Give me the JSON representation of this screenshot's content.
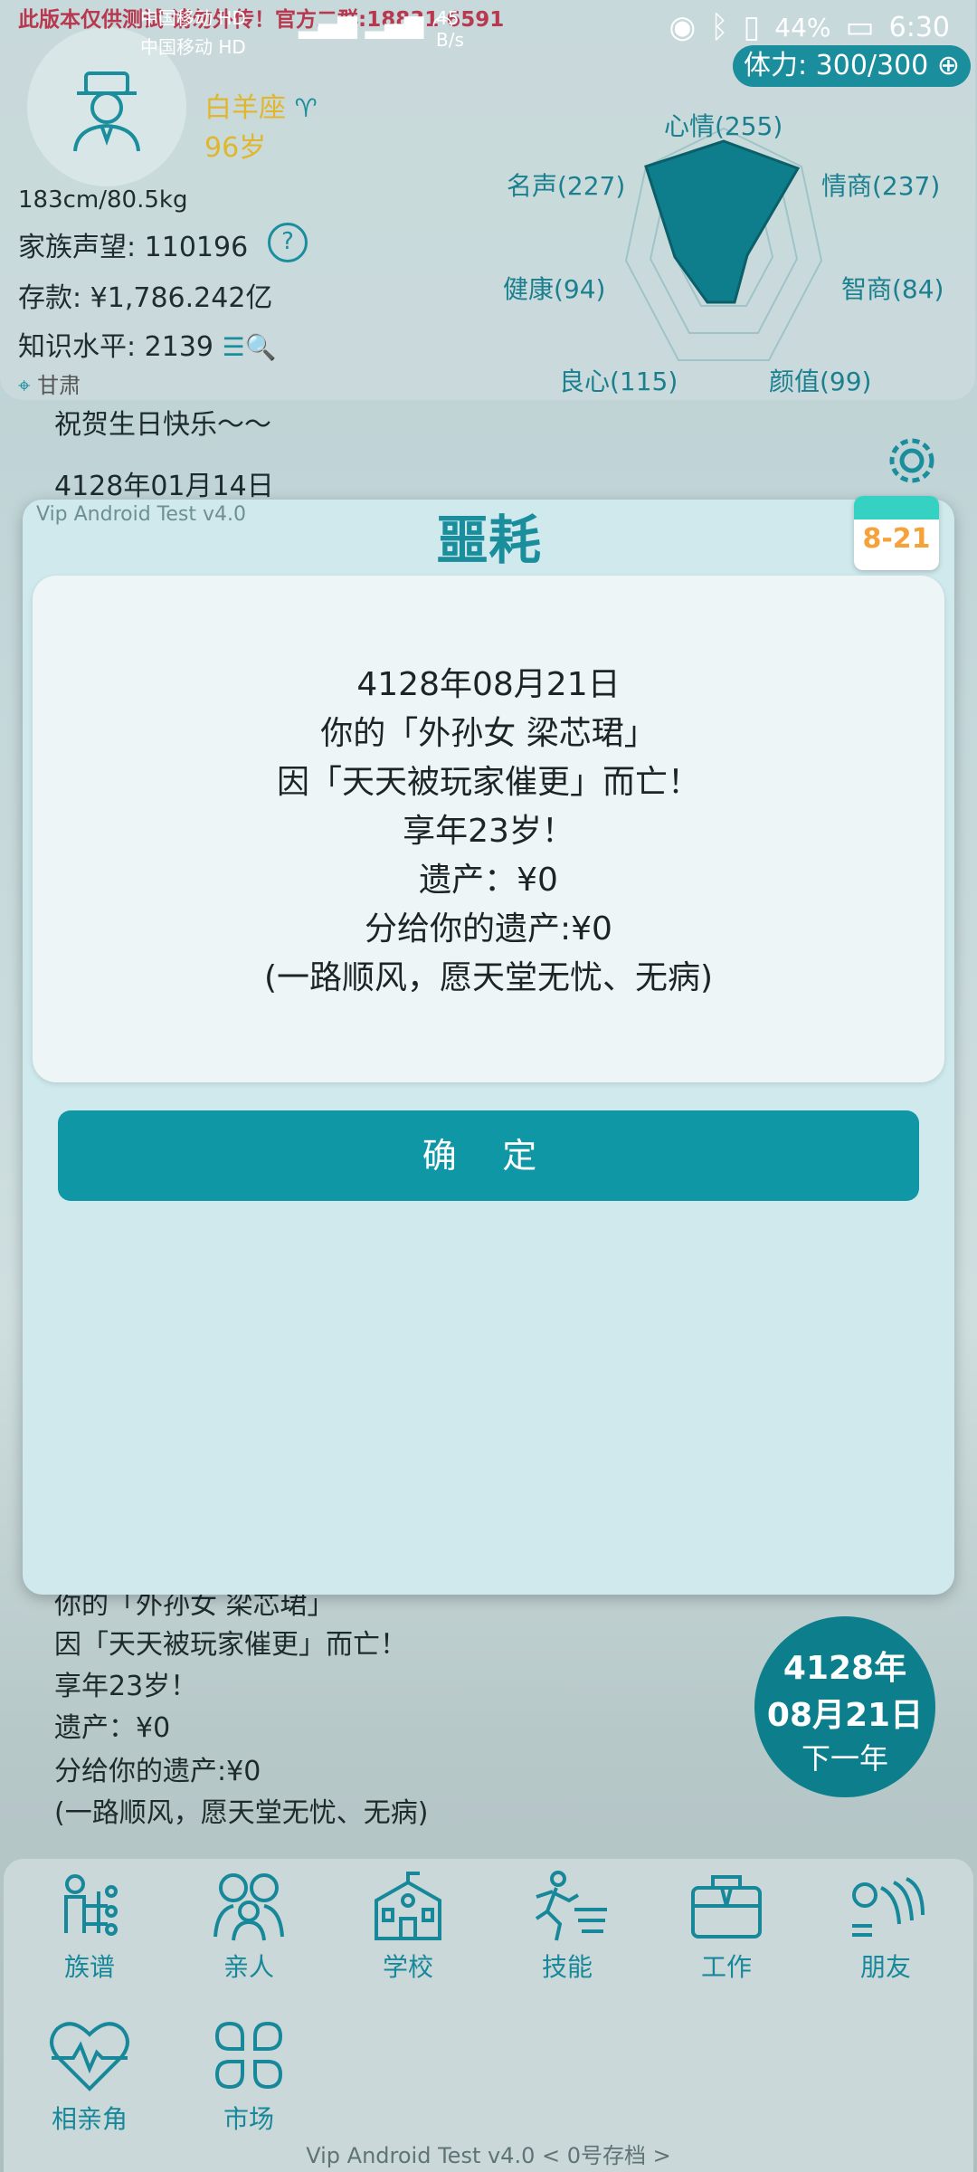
{
  "status_bar": {
    "notice": "此版本仅供测试 请勿外传！官方二群:18831 6591",
    "carrier1": "中国移动 HD",
    "carrier2": "中国移动 HD",
    "speed": "45 B/s",
    "battery": "44%",
    "time": "6:30"
  },
  "profile": {
    "sign": "白羊座",
    "age": "96岁",
    "height_weight": "183cm/80.5kg",
    "family_prestige": "家族声望: 110196",
    "savings": "存款: ¥1,786.242亿",
    "knowledge": "知识水平: 2139",
    "location": "甘肃",
    "energy": "体力: 300/300"
  },
  "radar": {
    "mood": "心情(255)",
    "eq": "情商(237)",
    "iq": "智商(84)",
    "looks": "颜值(99)",
    "conscience": "良心(115)",
    "health": "健康(94)",
    "fame": "名声(227)"
  },
  "background_log": {
    "birthday": "祝贺生日快乐～～",
    "date": "4128年01月14日",
    "line1": "你的「外孙女 梁芯珺」",
    "line2": "因「天天被玩家催更」而亡！",
    "line3": "享年23岁！",
    "line4": "遗产：¥0",
    "line5": "分给你的遗产:¥0",
    "line6": "(一路顺风，愿天堂无忧、无病)"
  },
  "calendar": {
    "date": "8-21"
  },
  "modal": {
    "version": "Vip Android Test v4.0",
    "title": "噩耗",
    "lines": [
      "4128年08月21日",
      "你的「外孙女 梁芯珺」",
      "因「天天被玩家催更」而亡！",
      "享年23岁！",
      "遗产：¥0",
      "分给你的遗产:¥0",
      "(一路顺风，愿天堂无忧、无病)"
    ],
    "confirm_label": "确 定"
  },
  "date_circle": {
    "year": "4128年",
    "monthday": "08月21日",
    "next": "下一年"
  },
  "nav": {
    "items": [
      "族谱",
      "亲人",
      "学校",
      "技能",
      "工作",
      "朋友",
      "相亲角",
      "市场"
    ]
  },
  "footer": "Vip Android Test v4.0 < 0号存档 >",
  "colors": {
    "accent": "#1a8e9c",
    "button": "#0f97a6",
    "gold": "#e0b72c"
  }
}
